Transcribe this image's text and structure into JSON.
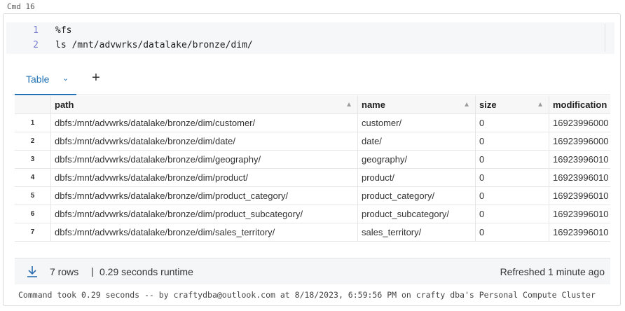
{
  "cmd_label": "Cmd 16",
  "code": {
    "lines": [
      {
        "num": "1",
        "text": "%fs"
      },
      {
        "num": "2",
        "text": "ls /mnt/advwrks/datalake/bronze/dim/"
      }
    ]
  },
  "tabs": {
    "table_label": "Table",
    "chevron": "⌄",
    "add": "+"
  },
  "table": {
    "headers": {
      "path": "path",
      "name": "name",
      "size": "size",
      "modification": "modification"
    },
    "rows": [
      {
        "idx": "1",
        "path": "dbfs:/mnt/advwrks/datalake/bronze/dim/customer/",
        "name": "customer/",
        "size": "0",
        "mod": "16923996000"
      },
      {
        "idx": "2",
        "path": "dbfs:/mnt/advwrks/datalake/bronze/dim/date/",
        "name": "date/",
        "size": "0",
        "mod": "16923996000"
      },
      {
        "idx": "3",
        "path": "dbfs:/mnt/advwrks/datalake/bronze/dim/geography/",
        "name": "geography/",
        "size": "0",
        "mod": "16923996010"
      },
      {
        "idx": "4",
        "path": "dbfs:/mnt/advwrks/datalake/bronze/dim/product/",
        "name": "product/",
        "size": "0",
        "mod": "16923996010"
      },
      {
        "idx": "5",
        "path": "dbfs:/mnt/advwrks/datalake/bronze/dim/product_category/",
        "name": "product_category/",
        "size": "0",
        "mod": "16923996010"
      },
      {
        "idx": "6",
        "path": "dbfs:/mnt/advwrks/datalake/bronze/dim/product_subcategory/",
        "name": "product_subcategory/",
        "size": "0",
        "mod": "16923996010"
      },
      {
        "idx": "7",
        "path": "dbfs:/mnt/advwrks/datalake/bronze/dim/sales_territory/",
        "name": "sales_territory/",
        "size": "0",
        "mod": "16923996010"
      }
    ]
  },
  "footer": {
    "rows": "7 rows",
    "separator": "|",
    "runtime": "0.29 seconds runtime",
    "refreshed": "Refreshed 1 minute ago"
  },
  "status": "Command took 0.29 seconds -- by craftydba@outlook.com at 8/18/2023, 6:59:56 PM on crafty dba's Personal Compute Cluster",
  "colors": {
    "accent": "#2272b4",
    "line_numbers": "#7a7fd0"
  }
}
